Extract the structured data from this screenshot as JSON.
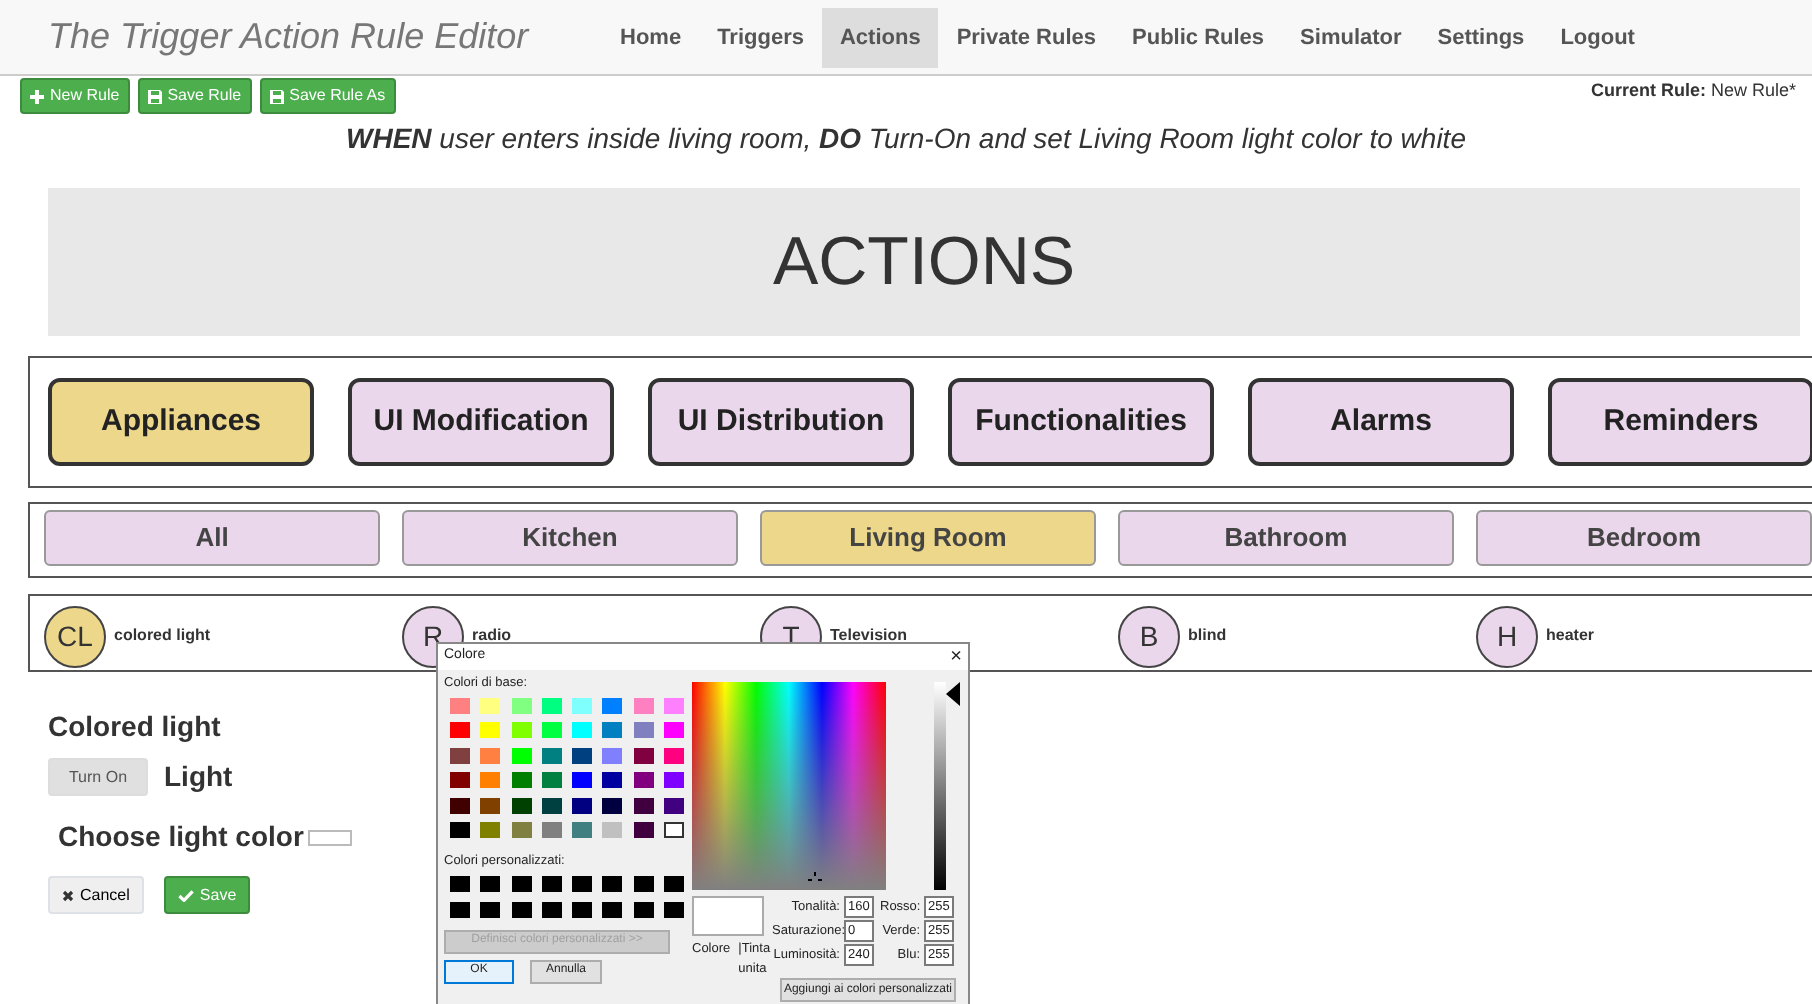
{
  "app_title": "The Trigger Action Rule Editor",
  "nav": [
    {
      "label": "Home",
      "selected": false
    },
    {
      "label": "Triggers",
      "selected": false
    },
    {
      "label": "Actions",
      "selected": true
    },
    {
      "label": "Private Rules",
      "selected": false
    },
    {
      "label": "Public Rules",
      "selected": false
    },
    {
      "label": "Simulator",
      "selected": false
    },
    {
      "label": "Settings",
      "selected": false
    },
    {
      "label": "Logout",
      "selected": false
    }
  ],
  "toolbar_buttons": [
    {
      "label": "New Rule",
      "kind": "add"
    },
    {
      "label": "Save Rule",
      "kind": "save"
    },
    {
      "label": "Save Rule As",
      "kind": "save"
    }
  ],
  "current_rule": {
    "label": "Current Rule:",
    "value": "New Rule*"
  },
  "rule_sentence": "**WHEN** user enters inside living room, **DO** Turn-On and set Living Room light color to white",
  "heading": "ACTIONS",
  "categories": [
    {
      "label": "Appliances",
      "selected": true
    },
    {
      "label": "UI Modification",
      "selected": false
    },
    {
      "label": "UI Distribution",
      "selected": false
    },
    {
      "label": "Functionalities",
      "selected": false
    },
    {
      "label": "Alarms",
      "selected": false
    },
    {
      "label": "Reminders",
      "selected": false
    }
  ],
  "rooms": [
    {
      "label": "All",
      "selected": false
    },
    {
      "label": "Kitchen",
      "selected": false
    },
    {
      "label": "Living Room",
      "selected": true
    },
    {
      "label": "Bathroom",
      "selected": false
    },
    {
      "label": "Bedroom",
      "selected": false
    }
  ],
  "devices": [
    {
      "initials": "CL",
      "name": "colored light",
      "selected": true
    },
    {
      "initials": "R",
      "name": "radio",
      "selected": false
    },
    {
      "initials": "T",
      "name": "Television",
      "selected": false
    },
    {
      "initials": "B",
      "name": "blind",
      "selected": false
    },
    {
      "initials": "H",
      "name": "heater",
      "selected": false
    }
  ],
  "device_panel": {
    "title": "Colored light",
    "toggle_button": "Turn On",
    "toggle_label": "Light",
    "color_label": "Choose light color",
    "color": "#ffffff",
    "cancel": "Cancel",
    "save": "Save"
  },
  "color_dialog": {
    "title": "Colore",
    "close": "×",
    "basic_label": "Colori di base:",
    "basic_colors": [
      {
        "color": "#ff8080",
        "selected": false
      },
      {
        "color": "#ffff80",
        "selected": false
      },
      {
        "color": "#80ff80",
        "selected": false
      },
      {
        "color": "#00ff80",
        "selected": false
      },
      {
        "color": "#80ffff",
        "selected": false
      },
      {
        "color": "#0080ff",
        "selected": false
      },
      {
        "color": "#ff80c0",
        "selected": false
      },
      {
        "color": "#ff80ff",
        "selected": false
      },
      {
        "color": "#ff0000",
        "selected": false
      },
      {
        "color": "#ffff00",
        "selected": false
      },
      {
        "color": "#80ff00",
        "selected": false
      },
      {
        "color": "#00ff40",
        "selected": false
      },
      {
        "color": "#00ffff",
        "selected": false
      },
      {
        "color": "#0080c0",
        "selected": false
      },
      {
        "color": "#8080c0",
        "selected": false
      },
      {
        "color": "#ff00ff",
        "selected": false
      },
      {
        "color": "#804040",
        "selected": false
      },
      {
        "color": "#ff8040",
        "selected": false
      },
      {
        "color": "#00ff00",
        "selected": false
      },
      {
        "color": "#008080",
        "selected": false
      },
      {
        "color": "#004080",
        "selected": false
      },
      {
        "color": "#8080ff",
        "selected": false
      },
      {
        "color": "#800040",
        "selected": false
      },
      {
        "color": "#ff0080",
        "selected": false
      },
      {
        "color": "#800000",
        "selected": false
      },
      {
        "color": "#ff8000",
        "selected": false
      },
      {
        "color": "#008000",
        "selected": false
      },
      {
        "color": "#008040",
        "selected": false
      },
      {
        "color": "#0000ff",
        "selected": false
      },
      {
        "color": "#0000a0",
        "selected": false
      },
      {
        "color": "#800080",
        "selected": false
      },
      {
        "color": "#8000ff",
        "selected": false
      },
      {
        "color": "#400000",
        "selected": false
      },
      {
        "color": "#804000",
        "selected": false
      },
      {
        "color": "#004000",
        "selected": false
      },
      {
        "color": "#004040",
        "selected": false
      },
      {
        "color": "#000080",
        "selected": false
      },
      {
        "color": "#000040",
        "selected": false
      },
      {
        "color": "#400040",
        "selected": false
      },
      {
        "color": "#400080",
        "selected": false
      },
      {
        "color": "#000000",
        "selected": false
      },
      {
        "color": "#808000",
        "selected": false
      },
      {
        "color": "#808040",
        "selected": false
      },
      {
        "color": "#808080",
        "selected": false
      },
      {
        "color": "#408080",
        "selected": false
      },
      {
        "color": "#c0c0c0",
        "selected": false
      },
      {
        "color": "#400040",
        "selected": false
      },
      {
        "color": "#ffffff",
        "selected": true
      }
    ],
    "custom_label": "Colori personalizzati:",
    "custom_colors": [
      {
        "color": "#000000"
      },
      {
        "color": "#000000"
      },
      {
        "color": "#000000"
      },
      {
        "color": "#000000"
      },
      {
        "color": "#000000"
      },
      {
        "color": "#000000"
      },
      {
        "color": "#000000"
      },
      {
        "color": "#000000"
      },
      {
        "color": "#000000"
      },
      {
        "color": "#000000"
      },
      {
        "color": "#000000"
      },
      {
        "color": "#000000"
      },
      {
        "color": "#000000"
      },
      {
        "color": "#000000"
      },
      {
        "color": "#000000"
      },
      {
        "color": "#000000"
      }
    ],
    "define_button": {
      "label": "Definisci colori personalizzati >>",
      "disabled": true
    },
    "ok": "OK",
    "cancel": "Annulla",
    "luminance": {
      "level": 1
    },
    "preview": {
      "color": "#ffffff",
      "label": "Colore",
      "sublabel": "|Tinta unita"
    },
    "hsl_fields": [
      {
        "label": "Tonalità:",
        "value": "160"
      },
      {
        "label": "Saturazione:",
        "value": "0"
      },
      {
        "label": "Luminosità:",
        "value": "240"
      }
    ],
    "rgb_fields": [
      {
        "label": "Rosso:",
        "value": "255"
      },
      {
        "label": "Verde:",
        "value": "255"
      },
      {
        "label": "Blu:",
        "value": "255"
      }
    ],
    "add_button": "Aggiungi ai colori personalizzati"
  }
}
